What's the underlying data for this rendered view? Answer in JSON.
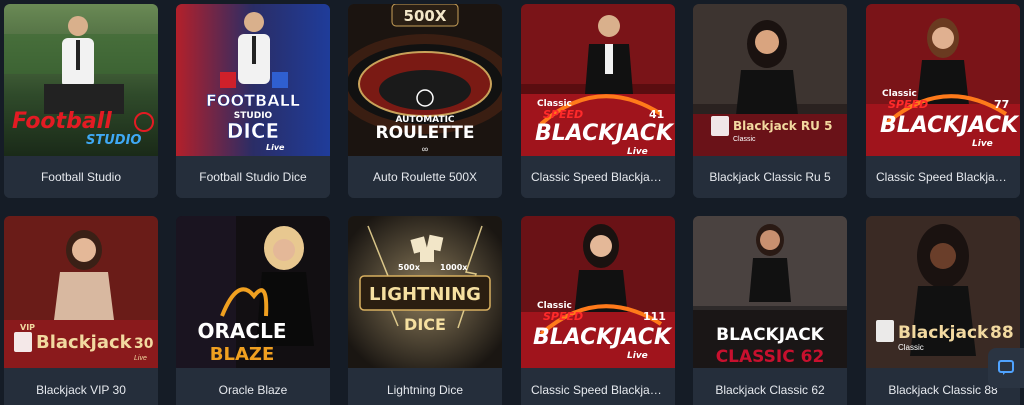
{
  "games": [
    {
      "title": "Football Studio",
      "logo": "Football",
      "logo2": "STUDIO"
    },
    {
      "title": "Football Studio Dice",
      "logo": "FOOTBALL",
      "logo2": "STUDIO",
      "logo3": "DICE",
      "logo4": "Live"
    },
    {
      "title": "Auto Roulette 500X",
      "badge": "500X",
      "logo": "AUTOMATIC",
      "logo2": "ROULETTE"
    },
    {
      "title": "Classic Speed Blackjack ...",
      "logo": "Classic",
      "logo2": "SPEED",
      "logo3": "BLACKJACK",
      "num": "41",
      "logo4": "Live"
    },
    {
      "title": "Blackjack Classic Ru 5",
      "logo": "Blackjack RU 5",
      "logo2": "Classic"
    },
    {
      "title": "Classic Speed Blackjack ...",
      "logo": "Classic",
      "logo2": "SPEED",
      "logo3": "BLACKJACK",
      "num": "77",
      "logo4": "Live"
    },
    {
      "title": "Blackjack VIP 30",
      "logo": "VIP",
      "logo2": "Blackjack",
      "num": "30",
      "logo4": "Live"
    },
    {
      "title": "Oracle Blaze",
      "logo": "ORACLE",
      "logo2": "BLAZE"
    },
    {
      "title": "Lightning Dice",
      "badge": "500x",
      "badge2": "1000x",
      "logo": "LIGHTNING",
      "logo2": "DICE"
    },
    {
      "title": "Classic Speed Blackjack ...",
      "logo": "Classic",
      "logo2": "SPEED",
      "logo3": "BLACKJACK",
      "num": "111",
      "logo4": "Live"
    },
    {
      "title": "Blackjack Classic 62",
      "logo": "BLACKJACK",
      "logo2": "CLASSIC 62"
    },
    {
      "title": "Blackjack Classic 88",
      "logo": "Blackjack",
      "num": "88",
      "logo2": "Classic"
    }
  ],
  "colors": {
    "page_bg": "#151c26",
    "caption_bg": "#252e3b",
    "caption_text": "#e6e9ee",
    "accent_red": "#c8102e",
    "accent_gold": "#f0a020"
  },
  "chat_button": {
    "icon": "chat-bubble-icon"
  }
}
